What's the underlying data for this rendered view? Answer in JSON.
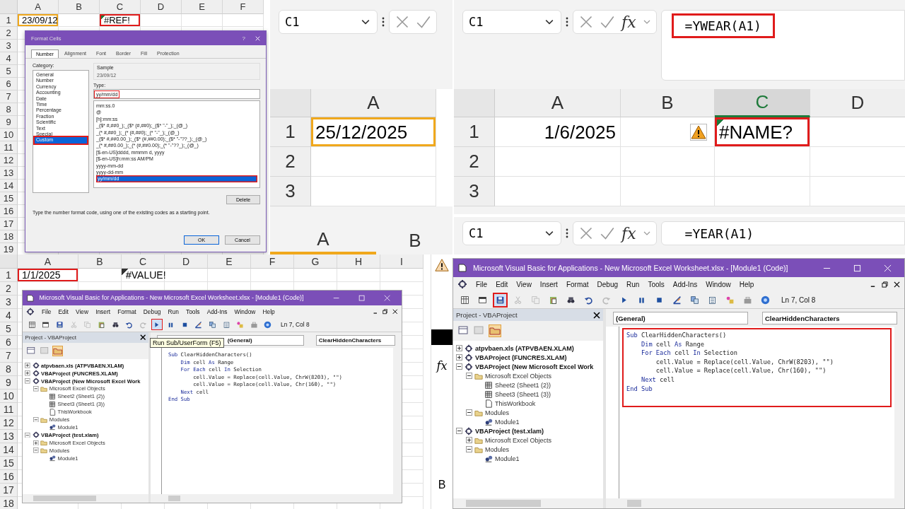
{
  "panels": [
    {
      "kind": "format_cells",
      "sheet": {
        "columns": [
          {
            "label": "A"
          },
          {
            "label": "B"
          },
          {
            "label": "C"
          },
          {
            "label": "D"
          },
          {
            "label": "E"
          },
          {
            "label": "F"
          }
        ],
        "rows": [
          "1",
          "2",
          "3",
          "4",
          "5",
          "6",
          "7",
          "8",
          "9",
          "10",
          "11",
          "12",
          "13",
          "14",
          "15",
          "16",
          "17",
          "18",
          "19"
        ],
        "first_row": [
          {
            "kind": "text",
            "text": "23/09/12",
            "color": "#f0a81c",
            "error_flag": false
          },
          {
            "kind": "empty"
          },
          {
            "kind": "text",
            "text": "#REF!",
            "color": "#e01b1b",
            "error_flag": true
          },
          {
            "kind": "empty"
          },
          {
            "kind": "empty"
          },
          {
            "kind": "empty"
          }
        ]
      },
      "dialog": {
        "title": "Format Cells",
        "help_button": "?",
        "tabs": [
          {
            "label": "Number",
            "selected": true
          },
          {
            "label": "Alignment",
            "selected": false
          },
          {
            "label": "Font",
            "selected": false
          },
          {
            "label": "Border",
            "selected": false
          },
          {
            "label": "Fill",
            "selected": false
          },
          {
            "label": "Protection",
            "selected": false
          }
        ],
        "category_label": "Category:",
        "categories": [
          {
            "label": "General",
            "selected": false
          },
          {
            "label": "Number",
            "selected": false
          },
          {
            "label": "Currency",
            "selected": false
          },
          {
            "label": "Accounting",
            "selected": false
          },
          {
            "label": "Date",
            "selected": false
          },
          {
            "label": "Time",
            "selected": false
          },
          {
            "label": "Percentage",
            "selected": false
          },
          {
            "label": "Fraction",
            "selected": false
          },
          {
            "label": "Scientific",
            "selected": false
          },
          {
            "label": "Text",
            "selected": false
          },
          {
            "label": "Special",
            "selected": false
          },
          {
            "label": "Custom",
            "selected": true
          }
        ],
        "sample_label": "Sample",
        "sample": "23/09/12",
        "type_label": "Type:",
        "type": "yy/mm/dd",
        "type_outlined": true,
        "formats": [
          {
            "label": "mm:ss.0",
            "selected": false
          },
          {
            "label": "@",
            "selected": false
          },
          {
            "label": "[h]:mm:ss",
            "selected": false
          },
          {
            "label": "_($* #,##0_);_($* (#,##0);_($* \"-\"_);_(@_)",
            "selected": false
          },
          {
            "label": "_(* #,##0_);_(* (#,##0);_(* \"-\"_);_(@_)",
            "selected": false
          },
          {
            "label": "_($* #,##0.00_);_($* (#,##0.00);_($* \"-\"??_);_(@_)",
            "selected": false
          },
          {
            "label": "_(* #,##0.00_);_(* (#,##0.00);_(* \"-\"??_);_(@_)",
            "selected": false
          },
          {
            "label": "[$-en-US]dddd, mmmm d, yyyy",
            "selected": false
          },
          {
            "label": "[$-en-US]h:mm:ss AM/PM",
            "selected": false
          },
          {
            "label": "yyyy-mm-dd",
            "selected": false
          },
          {
            "label": "yyyy-dd-mm",
            "selected": false
          },
          {
            "label": "yy/mm/dd",
            "selected": true
          }
        ],
        "delete_button": "Delete",
        "hint": "Type the number format code, using one of the existing codes as a starting point.",
        "ok_button": "OK",
        "cancel_button": "Cancel"
      }
    },
    {
      "kind": "cell_closeup",
      "formula_bar": {
        "name_box": "C1"
      },
      "sheet": {
        "columns": [
          {
            "label": "A"
          }
        ],
        "rows": [
          "1",
          "2",
          "3"
        ],
        "first_row": [
          {
            "kind": "text",
            "text": "25/12/2025",
            "color": "#f0a81c",
            "error_flag": false
          }
        ]
      },
      "lower_columns": [
        "A",
        "B"
      ]
    },
    {
      "kind": "formula_grid",
      "formula_bar": {
        "name_box": "C1",
        "fx": "fx",
        "formula": "=YWEAR(A1)",
        "color": "#e01b1b"
      },
      "sheet": {
        "columns": [
          {
            "label": "A",
            "selected": false
          },
          {
            "label": "B",
            "selected": false
          },
          {
            "label": "C",
            "selected": true
          },
          {
            "label": "D",
            "selected": false
          }
        ],
        "rows": [
          "1",
          "2",
          "3"
        ],
        "first_row": [
          {
            "kind": "number",
            "text": "1/6/2025",
            "error_flag": false
          },
          {
            "kind": "warning"
          },
          {
            "kind": "text",
            "text": "#NAME?",
            "color": "#e01b1b",
            "error_flag": true
          },
          {
            "kind": "empty"
          }
        ]
      }
    },
    {
      "kind": "formula_bar",
      "formula_bar": {
        "name_box": "C1",
        "fx": "fx",
        "formula": "=YEAR(A1)"
      }
    },
    {
      "kind": "vba_sheet",
      "sheet": {
        "columns": [
          {
            "label": "A"
          },
          {
            "label": "B"
          },
          {
            "label": "C"
          },
          {
            "label": "D"
          },
          {
            "label": "E"
          },
          {
            "label": "F"
          },
          {
            "label": "G"
          },
          {
            "label": "H"
          },
          {
            "label": "I"
          }
        ],
        "rows": [
          "1",
          "2",
          "3",
          "4",
          "5",
          "6",
          "7",
          "8",
          "9",
          "10",
          "11",
          "12",
          "13",
          "14",
          "15",
          "16",
          "17",
          "18"
        ],
        "first_row": [
          {
            "kind": "text",
            "text": "1/1/2025",
            "color": "#e01b1b",
            "error_flag": false
          },
          {
            "kind": "empty"
          },
          {
            "kind": "text",
            "text": "#VALUE!",
            "error_flag": true
          },
          {
            "kind": "empty"
          },
          {
            "kind": "empty"
          },
          {
            "kind": "empty"
          },
          {
            "kind": "empty"
          },
          {
            "kind": "empty"
          },
          {
            "kind": "empty"
          }
        ]
      },
      "edge": {
        "fx": "fx",
        "column": "B"
      },
      "tooltip": "Run Sub/UserForm (F5)",
      "vba": {
        "title": "Microsoft Visual Basic for Applications - New Microsoft Excel Worksheet.xlsx - [Module1 (Code)]",
        "menu": [
          "File",
          "Edit",
          "View",
          "Insert",
          "Format",
          "Debug",
          "Run",
          "Tools",
          "Add-Ins",
          "Window",
          "Help"
        ],
        "run_outlined": true,
        "save_outlined": false,
        "position": "Ln 7, Col 8",
        "project_title": "Project - VBAProject",
        "tree": [
          {
            "label": "atpvbaen.xls (ATPVBAEN.XLAM)",
            "kind": "project",
            "expanded": false
          },
          {
            "label": "VBAProject (FUNCRES.XLAM)",
            "kind": "project",
            "expanded": false
          },
          {
            "label": "VBAProject (New Microsoft Excel Work",
            "kind": "project",
            "expanded": true,
            "children": [
              {
                "label": "Microsoft Excel Objects",
                "kind": "folder",
                "expanded": true,
                "children": [
                  {
                    "label": "Sheet2 (Sheet1 (2))",
                    "kind": "sheet"
                  },
                  {
                    "label": "Sheet3 (Sheet1 (3))",
                    "kind": "sheet"
                  },
                  {
                    "label": "ThisWorkbook",
                    "kind": "workbook"
                  }
                ]
              },
              {
                "label": "Modules",
                "kind": "folder",
                "expanded": true,
                "children": [
                  {
                    "label": "Module1",
                    "kind": "module"
                  }
                ]
              }
            ]
          },
          {
            "label": "VBAProject (test.xlam)",
            "kind": "project",
            "expanded": true,
            "children": [
              {
                "label": "Microsoft Excel Objects",
                "kind": "folder",
                "expanded": false
              },
              {
                "label": "Modules",
                "kind": "folder",
                "expanded": true,
                "children": [
                  {
                    "label": "Module1",
                    "kind": "module"
                  }
                ]
              }
            ]
          }
        ],
        "object_box": "(General)",
        "procedure_box": "ClearHiddenCharacters",
        "code_outlined": false,
        "code": [
          {
            "parts": [
              {
                "text": "Sub",
                "keyword": true
              },
              {
                "text": " ClearHiddenCharacters()",
                "keyword": false
              }
            ]
          },
          {
            "parts": [
              {
                "text": "    Dim",
                "keyword": true
              },
              {
                "text": " cell ",
                "keyword": false
              },
              {
                "text": "As",
                "keyword": true
              },
              {
                "text": " Range",
                "keyword": false
              }
            ]
          },
          {
            "parts": [
              {
                "text": "    For Each",
                "keyword": true
              },
              {
                "text": " cell ",
                "keyword": false
              },
              {
                "text": "In",
                "keyword": true
              },
              {
                "text": " Selection",
                "keyword": false
              }
            ]
          },
          {
            "parts": [
              {
                "text": "        cell.Value = Replace(cell.Value, ChrW(8203), \"\")",
                "keyword": false
              }
            ]
          },
          {
            "parts": [
              {
                "text": "        cell.Value = Replace(cell.Value, Chr(160), \"\")",
                "keyword": false
              }
            ]
          },
          {
            "parts": [
              {
                "text": "    Next",
                "keyword": true
              },
              {
                "text": " cell",
                "keyword": false
              }
            ]
          },
          {
            "parts": [
              {
                "text": "End Sub",
                "keyword": true
              }
            ]
          }
        ]
      }
    },
    {
      "kind": "vba",
      "vba": {
        "title": "Microsoft Visual Basic for Applications - New Microsoft Excel Worksheet.xlsx - [Module1 (Code)]",
        "menu": [
          "File",
          "Edit",
          "View",
          "Insert",
          "Format",
          "Debug",
          "Run",
          "Tools",
          "Add-Ins",
          "Window",
          "Help"
        ],
        "run_outlined": false,
        "save_outlined": true,
        "position": "Ln 7, Col 8",
        "project_title": "Project - VBAProject",
        "tree": [
          {
            "label": "atpvbaen.xls (ATPVBAEN.XLAM)",
            "kind": "project",
            "expanded": false
          },
          {
            "label": "VBAProject (FUNCRES.XLAM)",
            "kind": "project",
            "expanded": false
          },
          {
            "label": "VBAProject (New Microsoft Excel Work",
            "kind": "project",
            "expanded": true,
            "children": [
              {
                "label": "Microsoft Excel Objects",
                "kind": "folder",
                "expanded": true,
                "children": [
                  {
                    "label": "Sheet2 (Sheet1 (2))",
                    "kind": "sheet"
                  },
                  {
                    "label": "Sheet3 (Sheet1 (3))",
                    "kind": "sheet"
                  },
                  {
                    "label": "ThisWorkbook",
                    "kind": "workbook"
                  }
                ]
              },
              {
                "label": "Modules",
                "kind": "folder",
                "expanded": true,
                "children": [
                  {
                    "label": "Module1",
                    "kind": "module"
                  }
                ]
              }
            ]
          },
          {
            "label": "VBAProject (test.xlam)",
            "kind": "project",
            "expanded": true,
            "children": [
              {
                "label": "Microsoft Excel Objects",
                "kind": "folder",
                "expanded": false
              },
              {
                "label": "Modules",
                "kind": "folder",
                "expanded": true,
                "children": [
                  {
                    "label": "Module1",
                    "kind": "module"
                  }
                ]
              }
            ]
          }
        ],
        "object_box": "(General)",
        "procedure_box": "ClearHiddenCharacters",
        "code_outlined": true,
        "code": [
          {
            "parts": [
              {
                "text": "Sub",
                "keyword": true
              },
              {
                "text": " ClearHiddenCharacters()",
                "keyword": false
              }
            ]
          },
          {
            "parts": [
              {
                "text": "    Dim",
                "keyword": true
              },
              {
                "text": " cell ",
                "keyword": false
              },
              {
                "text": "As",
                "keyword": true
              },
              {
                "text": " Range",
                "keyword": false
              }
            ]
          },
          {
            "parts": [
              {
                "text": "    For Each",
                "keyword": true
              },
              {
                "text": " cell ",
                "keyword": false
              },
              {
                "text": "In",
                "keyword": true
              },
              {
                "text": " Selection",
                "keyword": false
              }
            ]
          },
          {
            "parts": [
              {
                "text": "        cell.Value = Replace(cell.Value, ChrW(8203), \"\")",
                "keyword": false
              }
            ]
          },
          {
            "parts": [
              {
                "text": "        cell.Value = Replace(cell.Value, Chr(160), \"\")",
                "keyword": false
              }
            ]
          },
          {
            "parts": [
              {
                "text": "    Next",
                "keyword": true
              },
              {
                "text": " cell",
                "keyword": false
              }
            ]
          },
          {
            "parts": [
              {
                "text": "End Sub",
                "keyword": true
              }
            ]
          }
        ]
      }
    }
  ]
}
